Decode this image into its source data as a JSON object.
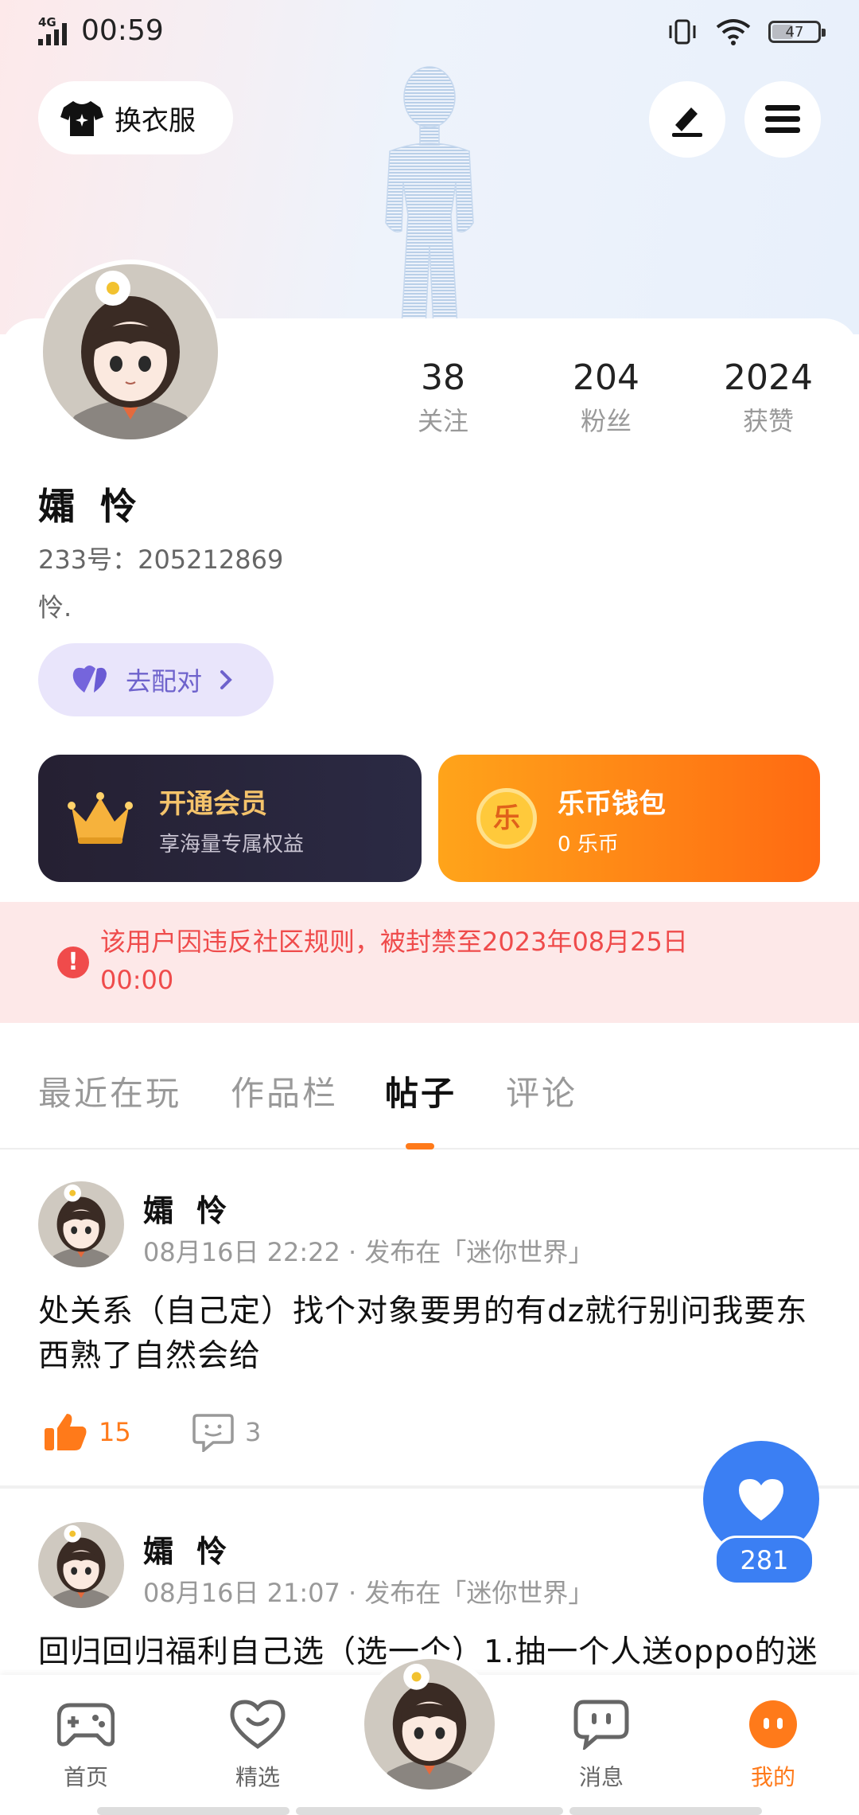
{
  "status_bar": {
    "network": "4G",
    "time": "00:59",
    "battery": "47",
    "battery_level": 0.47
  },
  "header": {
    "outfit_label": "换衣服",
    "edit_icon": "pen-icon",
    "menu_icon": "menu-icon"
  },
  "profile": {
    "name": "孀 怜",
    "uid": "233号：205212869",
    "bio": "怜.",
    "stats": [
      {
        "value": "38",
        "label": "关注"
      },
      {
        "value": "204",
        "label": "粉丝"
      },
      {
        "value": "2024",
        "label": "获赞"
      }
    ],
    "match_label": "去配对"
  },
  "cards": {
    "vip": {
      "title": "开通会员",
      "subtitle": "享海量专属权益"
    },
    "wallet": {
      "title": "乐币钱包",
      "subtitle": "0 乐币",
      "coin_glyph": "乐"
    }
  },
  "ban_notice": {
    "text": "该用户因违反社区规则，被封禁至2023年08月25日 00:00"
  },
  "tabs": [
    {
      "label": "最近在玩"
    },
    {
      "label": "作品栏"
    },
    {
      "label": "帖子",
      "active": true
    },
    {
      "label": "评论"
    }
  ],
  "posts": [
    {
      "author": "孀 怜",
      "meta": "08月16日 22:22 · 发布在「迷你世界」",
      "text": "处关系（自己定）找个对象要男的有dz就行别问我要东西熟了自然会给",
      "likes": "15",
      "comments": "3"
    },
    {
      "author": "孀 怜",
      "meta": "08月16日 21:07 · 发布在「迷你世界」",
      "text": "回归回归福利自己选（选一个）1.抽一个人送oppo的迷"
    }
  ],
  "fab": {
    "count": "281"
  },
  "bottom_nav": [
    {
      "label": "首页",
      "icon": "gamepad-icon"
    },
    {
      "label": "精选",
      "icon": "heart-chat-icon"
    },
    {
      "label": "",
      "icon": "avatar-center"
    },
    {
      "label": "消息",
      "icon": "chat-bubble-icon"
    },
    {
      "label": "我的",
      "icon": "profile-face-icon",
      "active": true
    }
  ],
  "colors": {
    "accent": "#ff7a1a",
    "ban": "#ef4b4b",
    "fab": "#3b7ff3",
    "match": "#6e62cc"
  }
}
